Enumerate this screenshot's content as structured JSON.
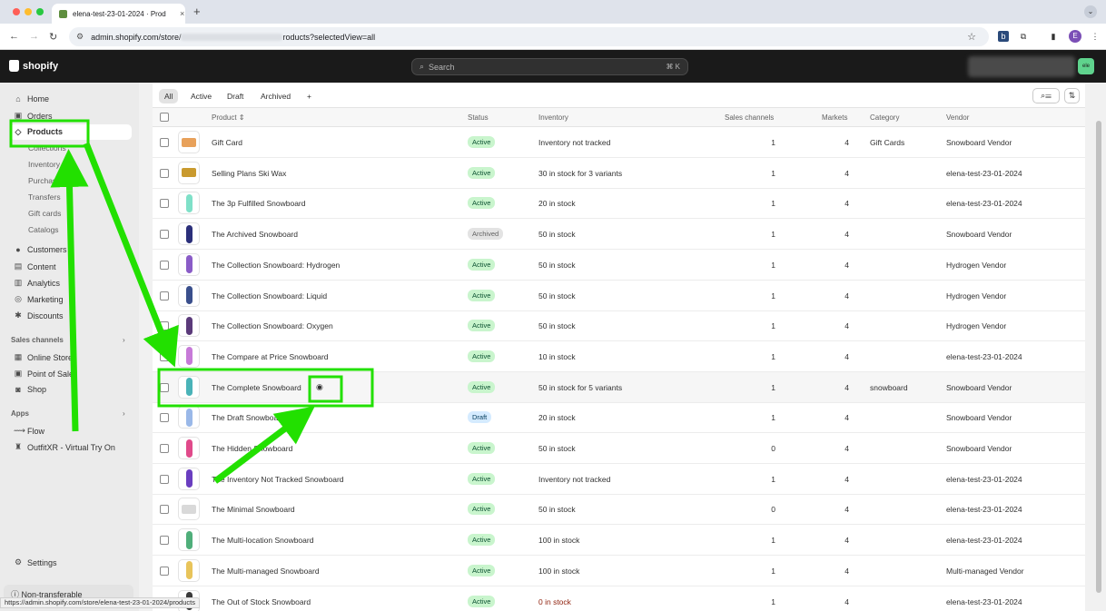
{
  "browser": {
    "tab_title": "elena-test-23-01-2024 · Prod",
    "tab_close": "×",
    "new_tab": "+",
    "url_prefix": "admin.shopify.com/store/",
    "url_suffix": "roducts?selectedView=all",
    "profile_initial": "E",
    "expand": "⌄"
  },
  "topbar": {
    "logo_text": "shopify",
    "search_placeholder": "Search",
    "search_shortcut": "⌘ K",
    "store_badge": "ele"
  },
  "sidebar": {
    "home": "Home",
    "orders": "Orders",
    "products": "Products",
    "sub_items": [
      "Collections",
      "Inventory",
      "Purchase orders",
      "Transfers",
      "Gift cards",
      "Catalogs"
    ],
    "customers": "Customers",
    "content": "Content",
    "analytics": "Analytics",
    "marketing": "Marketing",
    "discounts": "Discounts",
    "sales_channels_label": "Sales channels",
    "online_store": "Online Store",
    "point_of_sale": "Point of Sale",
    "shop": "Shop",
    "apps_label": "Apps",
    "flow": "Flow",
    "outfitxr": "OutfitXR - Virtual Try On",
    "settings": "Settings",
    "non_transferable": "Non-transferable"
  },
  "views": {
    "tabs": [
      "All",
      "Active",
      "Draft",
      "Archived"
    ],
    "add": "+"
  },
  "table": {
    "headers": {
      "product": "Product",
      "status": "Status",
      "inventory": "Inventory",
      "sales_channels": "Sales channels",
      "markets": "Markets",
      "category": "Category",
      "vendor": "Vendor"
    },
    "rows": [
      {
        "name": "Gift Card",
        "status": "Active",
        "status_type": "active",
        "inventory": "Inventory not tracked",
        "channels": "1",
        "markets": "4",
        "category": "Gift Cards",
        "vendor": "Snowboard Vendor",
        "thumb_color": "#e8a15a",
        "thumb_kind": "gc"
      },
      {
        "name": "Selling Plans Ski Wax",
        "status": "Active",
        "status_type": "active",
        "inventory": "30 in stock for 3 variants",
        "channels": "1",
        "markets": "4",
        "category": "",
        "vendor": "elena-test-23-01-2024",
        "thumb_color": "#c99a2e",
        "thumb_kind": "gc"
      },
      {
        "name": "The 3p Fulfilled Snowboard",
        "status": "Active",
        "status_type": "active",
        "inventory": "20 in stock",
        "channels": "1",
        "markets": "4",
        "category": "",
        "vendor": "elena-test-23-01-2024",
        "thumb_color": "#7fe0c8",
        "thumb_kind": "board"
      },
      {
        "name": "The Archived Snowboard",
        "status": "Archived",
        "status_type": "archived",
        "inventory": "50 in stock",
        "channels": "1",
        "markets": "4",
        "category": "",
        "vendor": "Snowboard Vendor",
        "thumb_color": "#2b2f7a",
        "thumb_kind": "board"
      },
      {
        "name": "The Collection Snowboard: Hydrogen",
        "status": "Active",
        "status_type": "active",
        "inventory": "50 in stock",
        "channels": "1",
        "markets": "4",
        "category": "",
        "vendor": "Hydrogen Vendor",
        "thumb_color": "#8a5cc7",
        "thumb_kind": "board"
      },
      {
        "name": "The Collection Snowboard: Liquid",
        "status": "Active",
        "status_type": "active",
        "inventory": "50 in stock",
        "channels": "1",
        "markets": "4",
        "category": "",
        "vendor": "Hydrogen Vendor",
        "thumb_color": "#3a4f8c",
        "thumb_kind": "board"
      },
      {
        "name": "The Collection Snowboard: Oxygen",
        "status": "Active",
        "status_type": "active",
        "inventory": "50 in stock",
        "channels": "1",
        "markets": "4",
        "category": "",
        "vendor": "Hydrogen Vendor",
        "thumb_color": "#5b3a7a",
        "thumb_kind": "board"
      },
      {
        "name": "The Compare at Price Snowboard",
        "status": "Active",
        "status_type": "active",
        "inventory": "10 in stock",
        "channels": "1",
        "markets": "4",
        "category": "",
        "vendor": "elena-test-23-01-2024",
        "thumb_color": "#c77ad8",
        "thumb_kind": "board"
      },
      {
        "name": "The Complete Snowboard",
        "status": "Active",
        "status_type": "active",
        "inventory": "50 in stock for 5 variants",
        "channels": "1",
        "markets": "4",
        "category": "snowboard",
        "vendor": "Snowboard Vendor",
        "thumb_color": "#4ab3b8",
        "thumb_kind": "board"
      },
      {
        "name": "The Draft Snowboard",
        "status": "Draft",
        "status_type": "draft",
        "inventory": "20 in stock",
        "channels": "1",
        "markets": "4",
        "category": "",
        "vendor": "Snowboard Vendor",
        "thumb_color": "#9ab8e8",
        "thumb_kind": "board"
      },
      {
        "name": "The Hidden Snowboard",
        "status": "Active",
        "status_type": "active",
        "inventory": "50 in stock",
        "channels": "0",
        "markets": "4",
        "category": "",
        "vendor": "Snowboard Vendor",
        "thumb_color": "#e04a8a",
        "thumb_kind": "board"
      },
      {
        "name": "The Inventory Not Tracked Snowboard",
        "status": "Active",
        "status_type": "active",
        "inventory": "Inventory not tracked",
        "channels": "1",
        "markets": "4",
        "category": "",
        "vendor": "elena-test-23-01-2024",
        "thumb_color": "#6a3ec0",
        "thumb_kind": "board"
      },
      {
        "name": "The Minimal Snowboard",
        "status": "Active",
        "status_type": "active",
        "inventory": "50 in stock",
        "channels": "0",
        "markets": "4",
        "category": "",
        "vendor": "elena-test-23-01-2024",
        "thumb_color": "#d9d9d9",
        "thumb_kind": "gc"
      },
      {
        "name": "The Multi-location Snowboard",
        "status": "Active",
        "status_type": "active",
        "inventory": "100 in stock",
        "channels": "1",
        "markets": "4",
        "category": "",
        "vendor": "elena-test-23-01-2024",
        "thumb_color": "#4fae7a",
        "thumb_kind": "board"
      },
      {
        "name": "The Multi-managed Snowboard",
        "status": "Active",
        "status_type": "active",
        "inventory": "100 in stock",
        "channels": "1",
        "markets": "4",
        "category": "",
        "vendor": "Multi-managed Vendor",
        "thumb_color": "#e8c45a",
        "thumb_kind": "board"
      },
      {
        "name": "The Out of Stock Snowboard",
        "status": "Active",
        "status_type": "active",
        "inventory": "0 in stock",
        "channels": "1",
        "markets": "4",
        "category": "",
        "vendor": "elena-test-23-01-2024",
        "thumb_color": "#3a3a3a",
        "thumb_kind": "board"
      }
    ]
  },
  "status_url": "https://admin.shopify.com/store/elena-test-23-01-2024/products",
  "colors": {
    "annotation": "#22e000",
    "active_badge": "#c9f5cd",
    "draft_badge": "#d5ebff"
  }
}
